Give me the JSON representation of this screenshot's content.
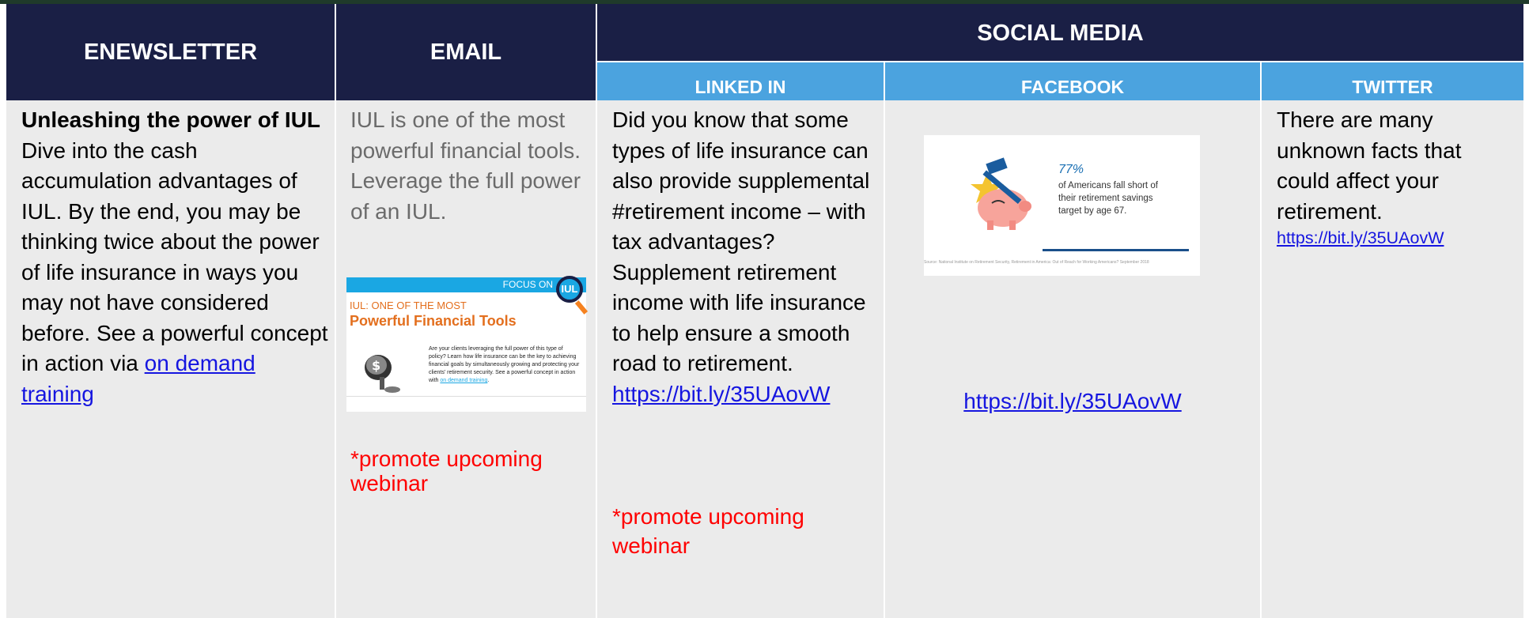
{
  "headers": {
    "enewsletter": "ENEWSLETTER",
    "email": "EMAIL",
    "social_media": "SOCIAL MEDIA",
    "linkedin": "LINKED IN",
    "facebook": "FACEBOOK",
    "twitter": "TWITTER"
  },
  "enewsletter": {
    "title": "Unleashing the power of IUL",
    "body": "Dive into the cash accumulation advantages of IUL. By the end, you may be thinking twice about the power of life insurance in ways you may not have considered before.  See a powerful concept in action via ",
    "link": "on demand training"
  },
  "email": {
    "body": "IUL is one of the most powerful financial tools. Leverage the full power of an IUL.",
    "promo": "*promote upcoming webinar",
    "thumb": {
      "focus": "FOCUS ON",
      "iul": "IUL",
      "subtitle": "IUL: ONE OF THE MOST",
      "title": "Powerful Financial Tools",
      "text": "Are your clients leveraging the full power of this type of policy? Learn how life insurance can be the key to achieving financial goals by simultaneously growing and protecting your clients' retirement security. See a powerful concept in action with ",
      "link": "on demand training",
      "end": "."
    }
  },
  "linkedin": {
    "body": "Did you know that some types of life insurance can also provide supplemental #retirement income – with tax advantages? Supplement retirement income with life insurance to help ensure a smooth road to retirement.",
    "link": "https://bit.ly/35UAovW",
    "promo": "*promote upcoming webinar"
  },
  "facebook": {
    "thumb": {
      "pct": "77%",
      "text": "of Americans fall short of their retirement savings target by age 67.",
      "source": "Source: National Institute on Retirement Security, Retirement in America: Out of Reach for Working Americans? September 2018"
    },
    "link": "https://bit.ly/35UAovW"
  },
  "twitter": {
    "body": "There are many unknown facts that could affect your retirement.",
    "link": "https://bit.ly/35UAovW"
  },
  "colors": {
    "header_dark": "#1a1f45",
    "header_light": "#4ba3df",
    "cell_bg": "#ebebeb",
    "link": "#1515e0",
    "promo": "#ff0000"
  }
}
